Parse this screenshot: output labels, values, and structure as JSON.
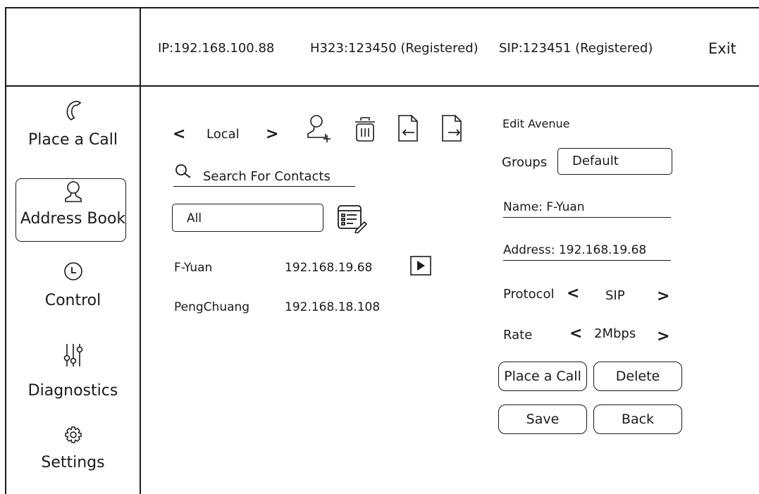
{
  "header": {
    "ip": "IP:192.168.100.88",
    "h323": "H323:123450 (Registered)",
    "sip": "SIP:123451 (Registered)",
    "exit": "Exit"
  },
  "sidebar": {
    "items": [
      {
        "label": "Place a Call",
        "icon": "phone-icon"
      },
      {
        "label": "Address Book",
        "icon": "user-icon",
        "active": true
      },
      {
        "label": "Control",
        "icon": "clock-icon"
      },
      {
        "label": "Diagnostics",
        "icon": "sliders-icon"
      },
      {
        "label": "Settings",
        "icon": "gear-icon"
      }
    ]
  },
  "toolbar": {
    "source": "Local",
    "prev": "<",
    "next": ">"
  },
  "search": {
    "label": "Search For Contacts"
  },
  "filter": {
    "value": "All"
  },
  "contacts": [
    {
      "name": "F-Yuan",
      "address": "192.168.19.68"
    },
    {
      "name": "PengChuang",
      "address": "192.168.18.108"
    }
  ],
  "edit": {
    "title": "Edit Avenue",
    "groups_label": "Groups",
    "groups_value": "Default",
    "name_line": "Name: F-Yuan",
    "address_line": "Address: 192.168.19.68",
    "protocol_label": "Protocol",
    "protocol_value": "SIP",
    "rate_label": "Rate",
    "rate_value": "2Mbps",
    "buttons": {
      "place_call": "Place a Call",
      "delete": "Delete",
      "save": "Save",
      "back": "Back"
    }
  }
}
